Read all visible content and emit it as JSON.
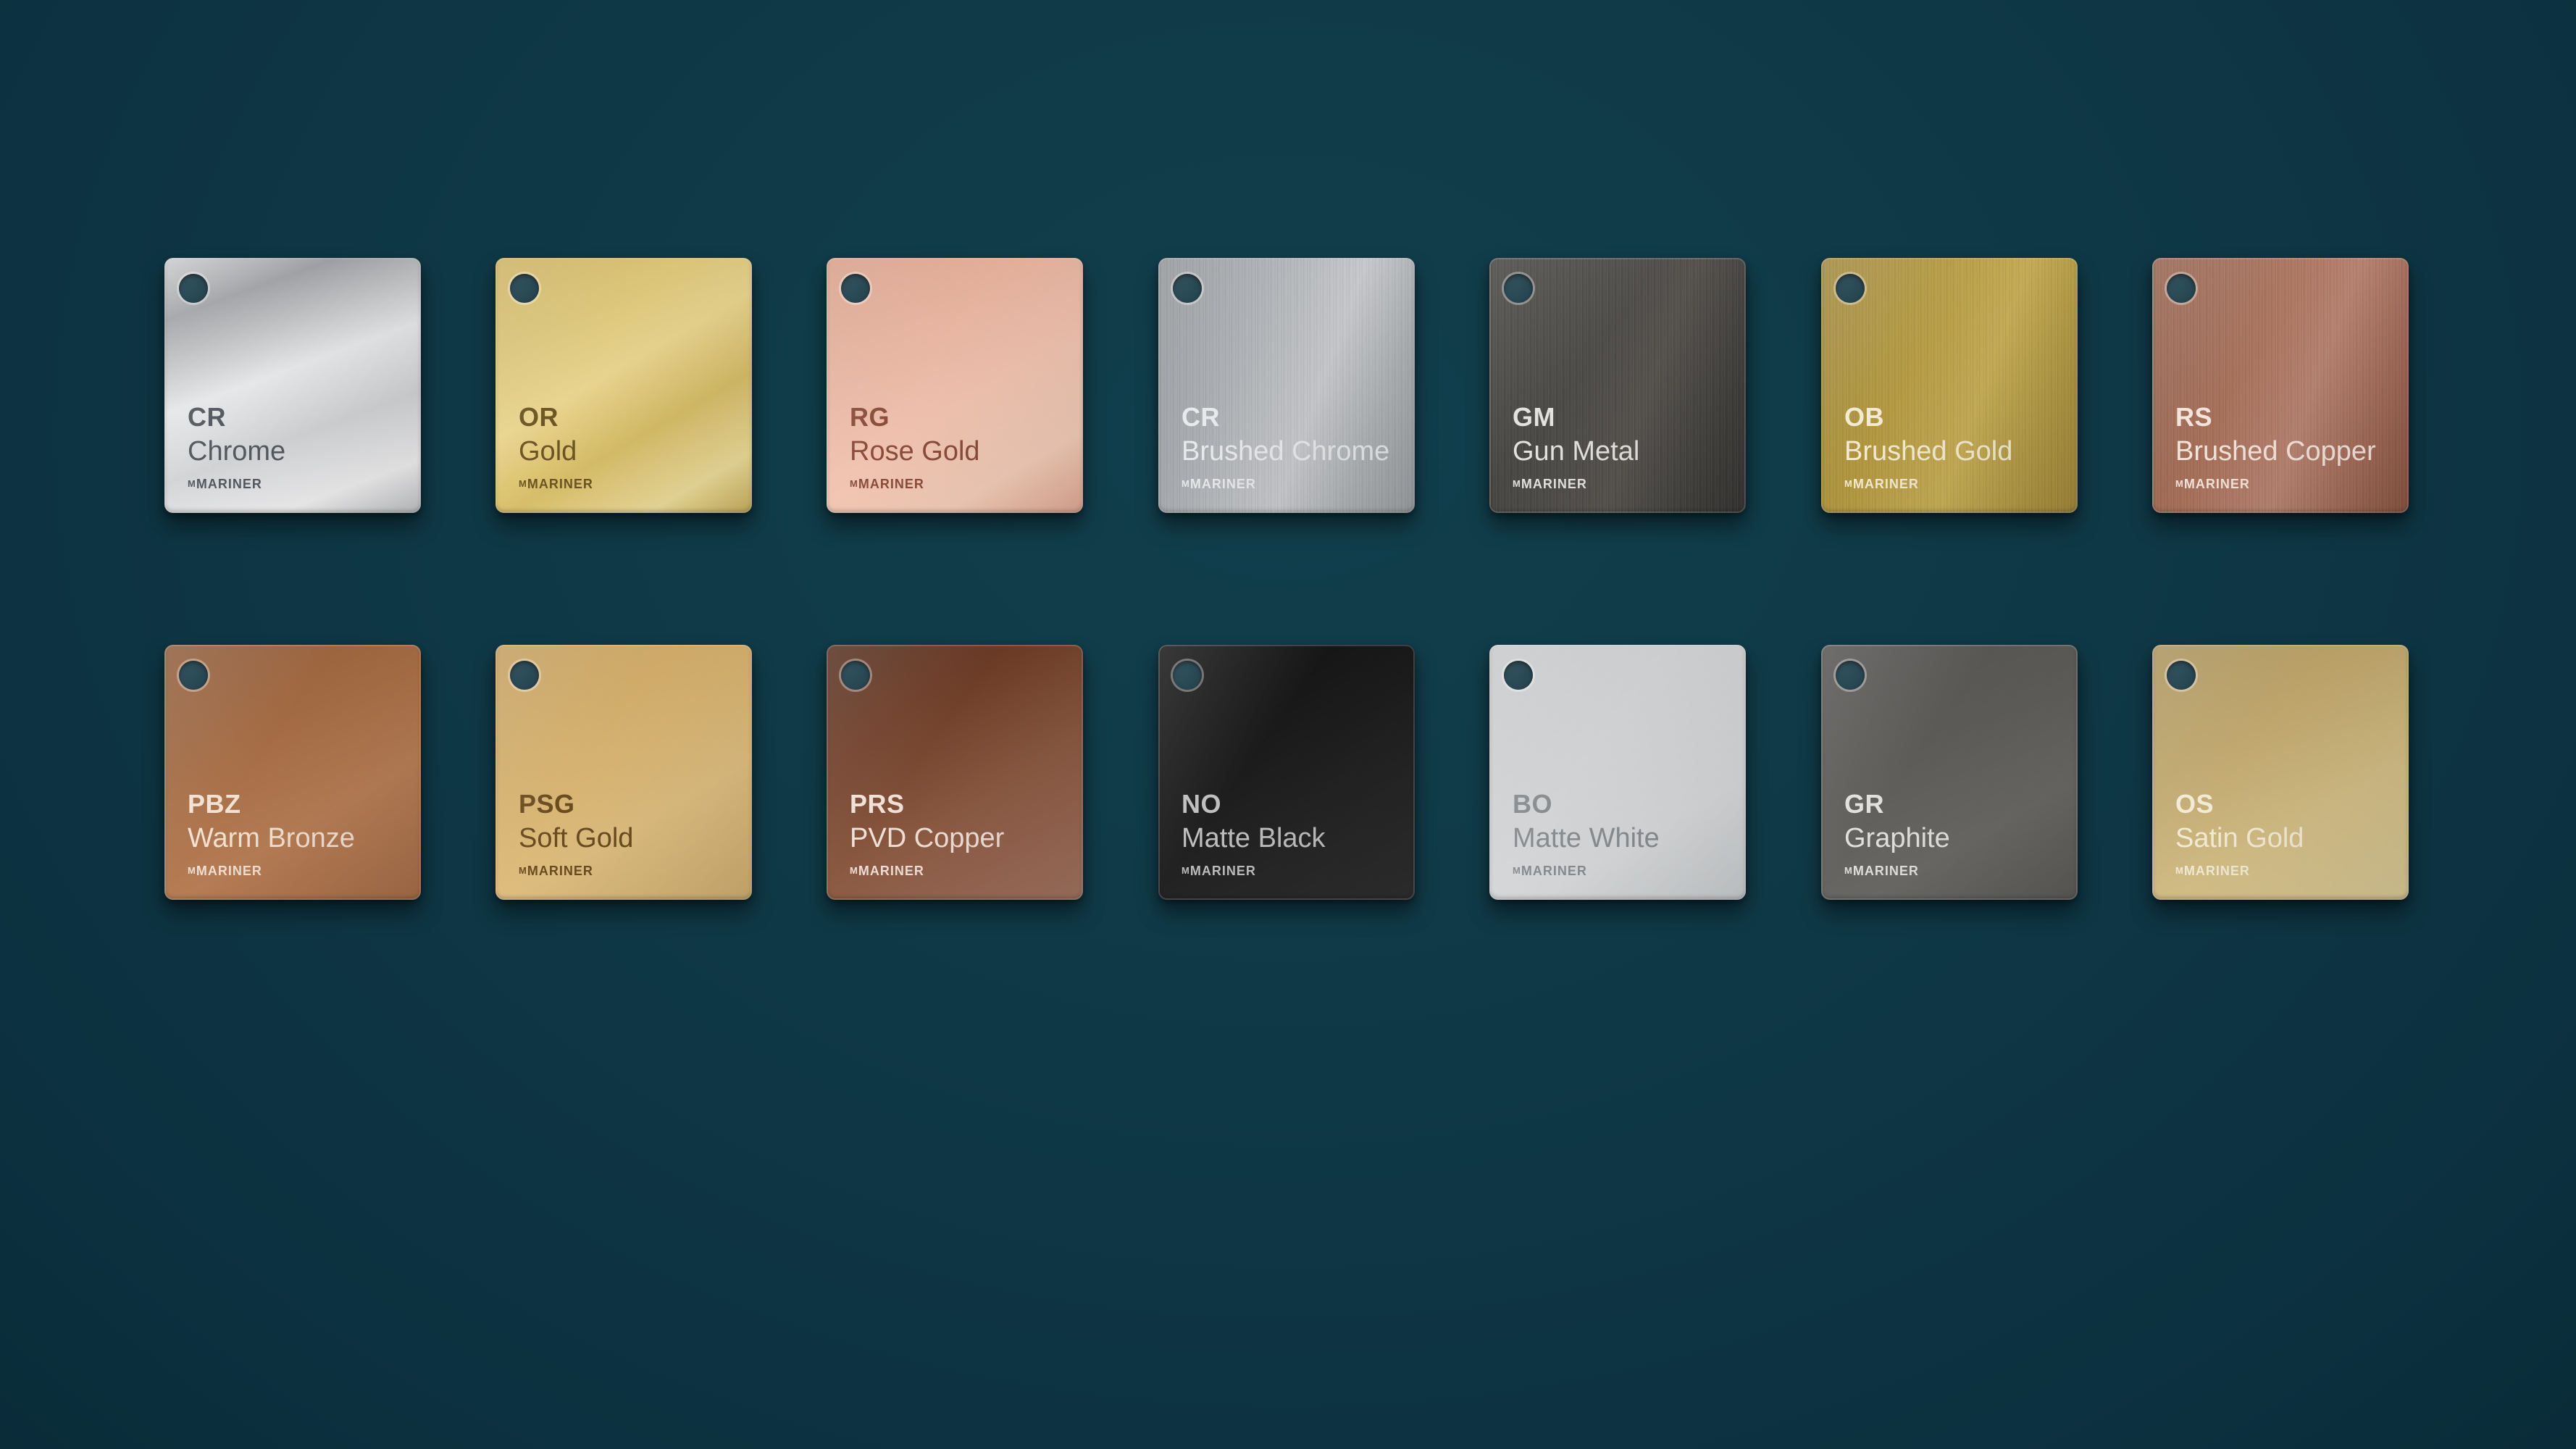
{
  "swatches": [
    {
      "code": "CR",
      "name": "Chrome",
      "brand": "MARINER",
      "brand_mark": "M",
      "style": "chrome"
    },
    {
      "code": "OR",
      "name": "Gold",
      "brand": "MARINER",
      "brand_mark": "M",
      "style": "gold"
    },
    {
      "code": "RG",
      "name": "Rose Gold",
      "brand": "MARINER",
      "brand_mark": "M",
      "style": "rosegold"
    },
    {
      "code": "CR",
      "name": "Brushed Chrome",
      "brand": "MARINER",
      "brand_mark": "M",
      "style": "brushedchrome"
    },
    {
      "code": "GM",
      "name": "Gun Metal",
      "brand": "MARINER",
      "brand_mark": "M",
      "style": "gunmetal"
    },
    {
      "code": "OB",
      "name": "Brushed Gold",
      "brand": "MARINER",
      "brand_mark": "M",
      "style": "brushedgold"
    },
    {
      "code": "RS",
      "name": "Brushed Copper",
      "brand": "MARINER",
      "brand_mark": "M",
      "style": "brushedcopper"
    },
    {
      "code": "PBZ",
      "name": "Warm Bronze",
      "brand": "MARINER",
      "brand_mark": "M",
      "style": "warmbronze"
    },
    {
      "code": "PSG",
      "name": "Soft Gold",
      "brand": "MARINER",
      "brand_mark": "M",
      "style": "softgold"
    },
    {
      "code": "PRS",
      "name": "PVD Copper",
      "brand": "MARINER",
      "brand_mark": "M",
      "style": "pvdcopper"
    },
    {
      "code": "NO",
      "name": "Matte Black",
      "brand": "MARINER",
      "brand_mark": "M",
      "style": "matteblack"
    },
    {
      "code": "BO",
      "name": "Matte White",
      "brand": "MARINER",
      "brand_mark": "M",
      "style": "mattewhite"
    },
    {
      "code": "GR",
      "name": "Graphite",
      "brand": "MARINER",
      "brand_mark": "M",
      "style": "graphite"
    },
    {
      "code": "OS",
      "name": "Satin Gold",
      "brand": "MARINER",
      "brand_mark": "M",
      "style": "satingold"
    }
  ],
  "colors": {
    "background": "#0f3846"
  }
}
